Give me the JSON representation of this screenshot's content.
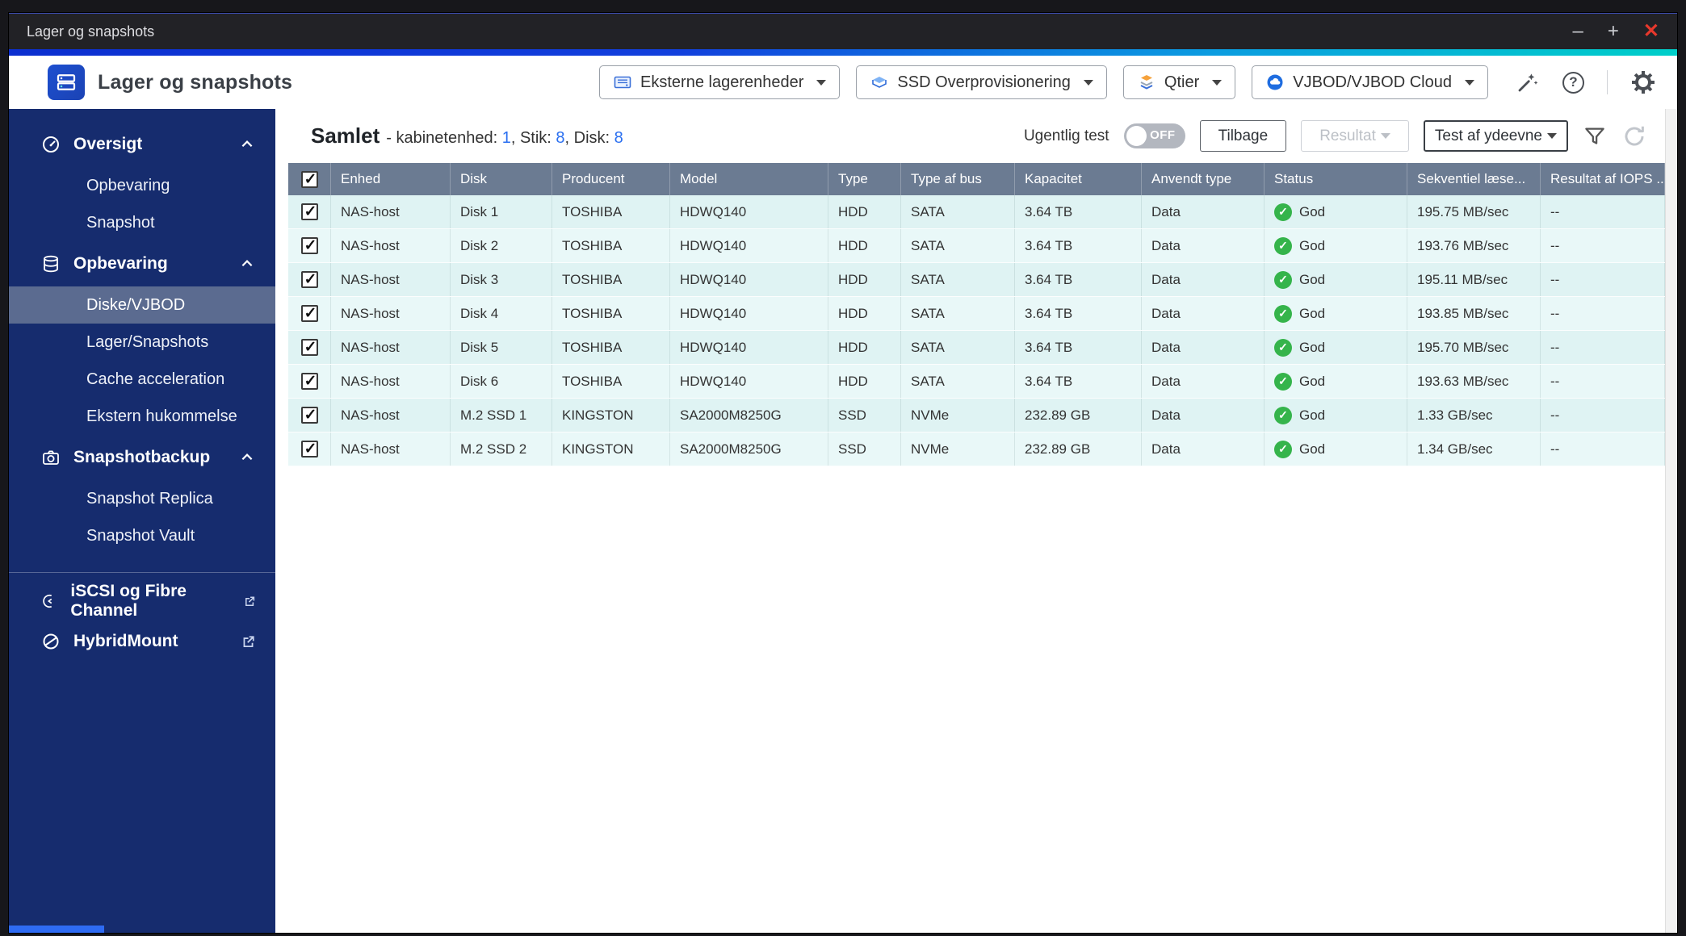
{
  "window": {
    "title": "Lager og snapshots",
    "minimize": "–",
    "maximize": "+",
    "close": "✕"
  },
  "header": {
    "app_title": "Lager og snapshots",
    "dropdowns": [
      {
        "label": "Eksterne lagerenheder",
        "icon": "external-storage-icon"
      },
      {
        "label": "SSD Overprovisionering",
        "icon": "ssd-overprovisioning-icon"
      },
      {
        "label": "Qtier",
        "icon": "qtier-icon"
      },
      {
        "label": "VJBOD/VJBOD Cloud",
        "icon": "vjbod-cloud-icon"
      }
    ],
    "icons": [
      "wizard-wand-icon",
      "help-icon",
      "settings-gear-icon"
    ]
  },
  "sidebar": {
    "sections": [
      {
        "label": "Oversigt",
        "icon": "gauge-icon",
        "items": [
          {
            "label": "Opbevaring"
          },
          {
            "label": "Snapshot"
          }
        ]
      },
      {
        "label": "Opbevaring",
        "icon": "storage-stack-icon",
        "items": [
          {
            "label": "Diske/VJBOD",
            "selected": true
          },
          {
            "label": "Lager/Snapshots"
          },
          {
            "label": "Cache acceleration"
          },
          {
            "label": "Ekstern hukommelse"
          }
        ]
      },
      {
        "label": "Snapshotbackup",
        "icon": "snapshot-camera-icon",
        "items": [
          {
            "label": "Snapshot Replica"
          },
          {
            "label": "Snapshot Vault"
          }
        ]
      }
    ],
    "links": [
      {
        "label": "iSCSI og Fibre Channel",
        "icon": "iscsi-icon"
      },
      {
        "label": "HybridMount",
        "icon": "hybridmount-icon"
      }
    ]
  },
  "toolbar": {
    "summary": {
      "title": "Samlet",
      "label1": "- kabinetenhed: ",
      "value1": "1",
      "label2": ", Stik: ",
      "value2": "8",
      "label3": ", Disk: ",
      "value3": "8"
    },
    "weekly_test_label": "Ugentlig test",
    "toggle_state": "OFF",
    "back_button": "Tilbage",
    "result_button": "Resultat",
    "performance_button": "Test af ydeevne"
  },
  "table": {
    "all_checked": true,
    "headers": [
      "Enhed",
      "Disk",
      "Producent",
      "Model",
      "Type",
      "Type af bus",
      "Kapacitet",
      "Anvendt type",
      "Status",
      "Sekventiel læse...",
      "Resultat af IOPS ..."
    ],
    "rows": [
      {
        "checked": true,
        "enhed": "NAS-host",
        "disk": "Disk 1",
        "producent": "TOSHIBA",
        "model": "HDWQ140",
        "type": "HDD",
        "bus": "SATA",
        "kapacitet": "3.64 TB",
        "anvendt": "Data",
        "status": "God",
        "seq": "195.75 MB/sec",
        "iops": "--"
      },
      {
        "checked": true,
        "enhed": "NAS-host",
        "disk": "Disk 2",
        "producent": "TOSHIBA",
        "model": "HDWQ140",
        "type": "HDD",
        "bus": "SATA",
        "kapacitet": "3.64 TB",
        "anvendt": "Data",
        "status": "God",
        "seq": "193.76 MB/sec",
        "iops": "--"
      },
      {
        "checked": true,
        "enhed": "NAS-host",
        "disk": "Disk 3",
        "producent": "TOSHIBA",
        "model": "HDWQ140",
        "type": "HDD",
        "bus": "SATA",
        "kapacitet": "3.64 TB",
        "anvendt": "Data",
        "status": "God",
        "seq": "195.11 MB/sec",
        "iops": "--"
      },
      {
        "checked": true,
        "enhed": "NAS-host",
        "disk": "Disk 4",
        "producent": "TOSHIBA",
        "model": "HDWQ140",
        "type": "HDD",
        "bus": "SATA",
        "kapacitet": "3.64 TB",
        "anvendt": "Data",
        "status": "God",
        "seq": "193.85 MB/sec",
        "iops": "--"
      },
      {
        "checked": true,
        "enhed": "NAS-host",
        "disk": "Disk 5",
        "producent": "TOSHIBA",
        "model": "HDWQ140",
        "type": "HDD",
        "bus": "SATA",
        "kapacitet": "3.64 TB",
        "anvendt": "Data",
        "status": "God",
        "seq": "195.70 MB/sec",
        "iops": "--"
      },
      {
        "checked": true,
        "enhed": "NAS-host",
        "disk": "Disk 6",
        "producent": "TOSHIBA",
        "model": "HDWQ140",
        "type": "HDD",
        "bus": "SATA",
        "kapacitet": "3.64 TB",
        "anvendt": "Data",
        "status": "God",
        "seq": "193.63 MB/sec",
        "iops": "--"
      },
      {
        "checked": true,
        "enhed": "NAS-host",
        "disk": "M.2 SSD 1",
        "producent": "KINGSTON",
        "model": "SA2000M8250G",
        "type": "SSD",
        "bus": "NVMe",
        "kapacitet": "232.89 GB",
        "anvendt": "Data",
        "status": "God",
        "seq": "1.33 GB/sec",
        "iops": "--"
      },
      {
        "checked": true,
        "enhed": "NAS-host",
        "disk": "M.2 SSD 2",
        "producent": "KINGSTON",
        "model": "SA2000M8250G",
        "type": "SSD",
        "bus": "NVMe",
        "kapacitet": "232.89 GB",
        "anvendt": "Data",
        "status": "God",
        "seq": "1.34 GB/sec",
        "iops": "--"
      }
    ]
  },
  "colors": {
    "accent_blue": "#2a6ff0",
    "status_green": "#35b44b",
    "sidebar_bg": "#162c6e",
    "table_header_bg": "#6b7b92",
    "row_bg": "#dff3f3"
  }
}
